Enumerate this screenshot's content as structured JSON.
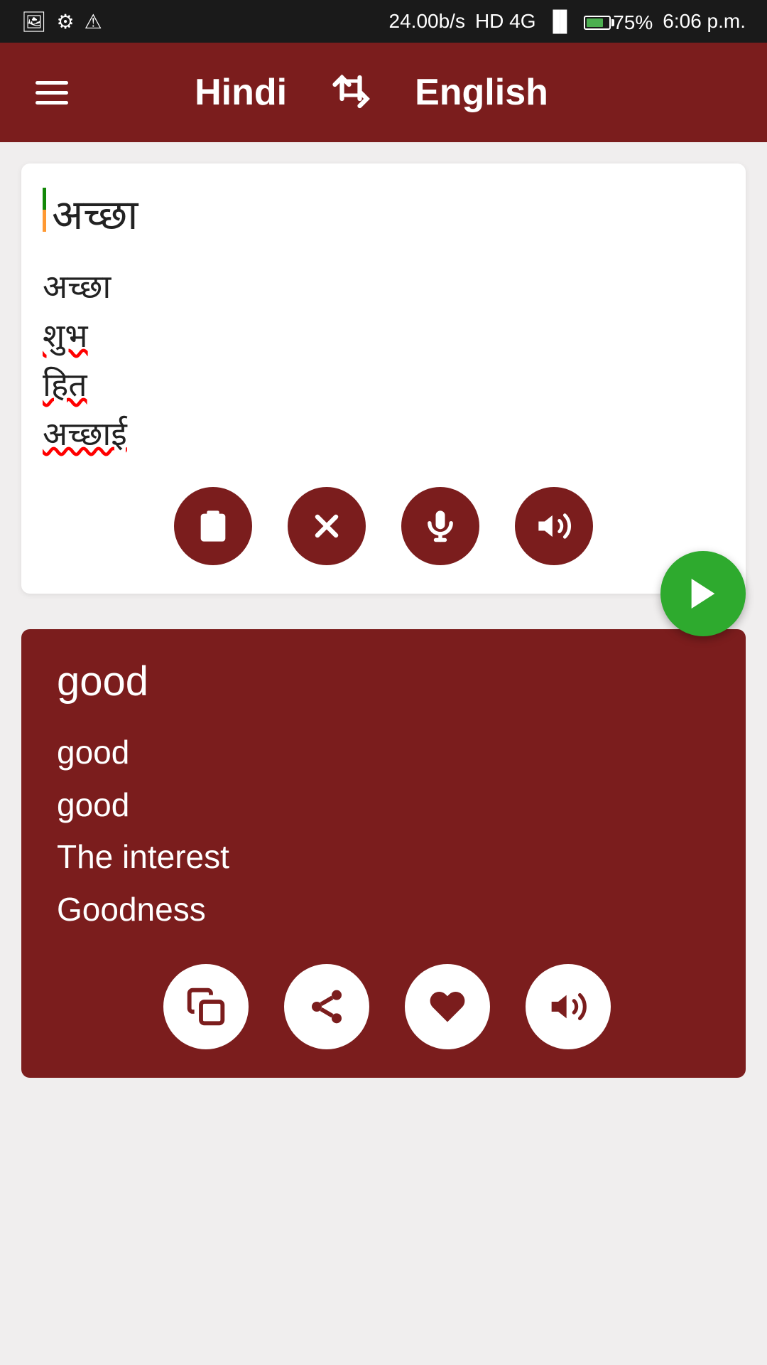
{
  "statusBar": {
    "speed": "24.00b/s",
    "network": "HD 4G",
    "battery": "75%",
    "time": "6:06 p.m."
  },
  "navbar": {
    "sourceLang": "Hindi",
    "targetLang": "English",
    "swapLabel": "⇄"
  },
  "inputPanel": {
    "mainText": "अच्छा",
    "suggestions": [
      {
        "text": "अच्छा",
        "hasUnderline": false
      },
      {
        "text": "शुभ",
        "hasUnderline": true
      },
      {
        "text": "हित",
        "hasUnderline": true
      },
      {
        "text": "अच्छाई",
        "hasUnderline": true
      }
    ],
    "controls": [
      {
        "name": "clipboard",
        "label": "clipboard-icon"
      },
      {
        "name": "clear",
        "label": "clear-icon"
      },
      {
        "name": "microphone",
        "label": "microphone-icon"
      },
      {
        "name": "speaker",
        "label": "speaker-icon"
      }
    ]
  },
  "outputPanel": {
    "mainText": "good",
    "suggestions": [
      "good",
      "good",
      "The interest",
      "Goodness"
    ],
    "controls": [
      {
        "name": "copy",
        "label": "copy-icon"
      },
      {
        "name": "share",
        "label": "share-icon"
      },
      {
        "name": "favorite",
        "label": "heart-icon"
      },
      {
        "name": "speaker",
        "label": "speaker-icon"
      }
    ]
  },
  "submitButton": {
    "label": "send"
  }
}
